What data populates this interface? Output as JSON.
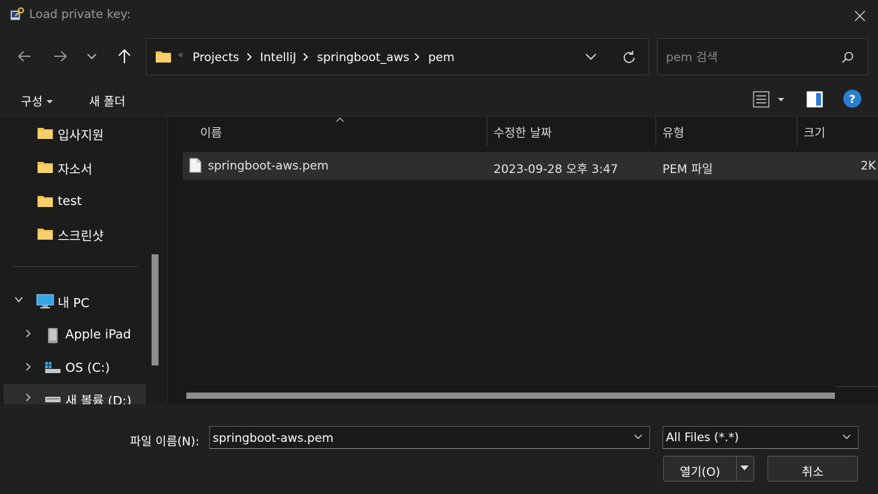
{
  "window": {
    "title": "Load private key:"
  },
  "address": {
    "breadcrumbs": [
      "Projects",
      "IntelliJ",
      "springboot_aws",
      "pem"
    ],
    "overflow_glyph": "«"
  },
  "search": {
    "placeholder": "pem 검색"
  },
  "toolbar": {
    "organize_label": "구성",
    "new_folder_label": "새 폴더",
    "help_label": "?"
  },
  "sidebar": {
    "items": [
      {
        "label": "입사지원",
        "icon": "folder-icon"
      },
      {
        "label": "자소서",
        "icon": "folder-icon"
      },
      {
        "label": "test",
        "icon": "folder-icon"
      },
      {
        "label": "스크린샷",
        "icon": "folder-icon"
      },
      {
        "label": "내 PC",
        "icon": "monitor-icon",
        "expanded": true
      },
      {
        "label": "Apple iPad",
        "icon": "ipad-icon"
      },
      {
        "label": "OS (C:)",
        "icon": "drive-icon"
      },
      {
        "label": "새 볼륨 (D:)",
        "icon": "drive-icon",
        "selected": true
      }
    ]
  },
  "columns": {
    "name": "이름",
    "modified": "수정한 날짜",
    "type": "유형",
    "size": "크기"
  },
  "files": [
    {
      "name": "springboot-aws.pem",
      "modified": "2023-09-28 오후 3:47",
      "type": "PEM 파일",
      "size": "2K"
    }
  ],
  "footer": {
    "filename_label": "파일 이름(N):",
    "filename_value": "springboot-aws.pem",
    "filetype_value": "All Files (*.*)",
    "open_label": "열기(O)",
    "cancel_label": "취소"
  },
  "colors": {
    "background": "#202020",
    "list_background": "#191919",
    "folder": "#f2c14e",
    "accent": "#2a7fd0"
  }
}
